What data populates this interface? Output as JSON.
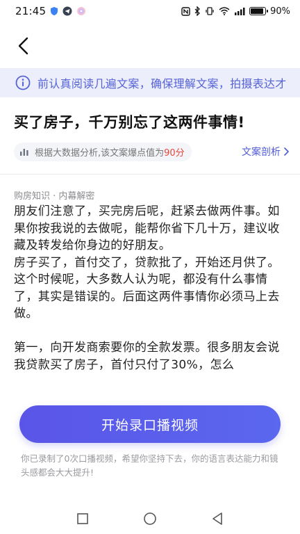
{
  "status_bar": {
    "time": "21:45",
    "battery_text": "90%",
    "battery_level": 0.9,
    "icons": [
      "shield-icon",
      "telegram-icon",
      "color-wheel-icon",
      "nfc-icon",
      "bluetooth-icon",
      "vibrate-icon",
      "wifi-icon",
      "signal-icon",
      "battery-icon"
    ]
  },
  "header": {
    "back_icon": "chevron-left-icon"
  },
  "tip_banner": {
    "icon": "info-icon",
    "text": "前认真阅读几遍文案，确保理解文案，拍摄表达才",
    "color": "#5563d6"
  },
  "article": {
    "title": "买了房子，千万别忘了这两件事情!",
    "score_prefix": "根据大数据分析,该文案爆点值为",
    "score_value": "90分",
    "analysis_link": "文案剖析",
    "category": "购房知识 · 内幕解密",
    "paragraphs": [
      "朋友们注意了，买完房后呢，赶紧去做两件事。如果你按我说的去做呢，能帮你省下几十万，建议收藏及转发给你身边的好朋友。",
      "房子买了，首付交了，贷款批了，开始还月供了。这个时候呢，大多数人认为呢，都没有什么事情了，其实是错误的。后面这两件事情你必须马上去做。",
      "第一，向开发商索要你的全款发票。很多朋友会说我贷款买了房子，首付只付了30%，怎么"
    ]
  },
  "record": {
    "button_label": "开始录口播视频",
    "note": "你已录制了0次口播视频，希望你坚持下去，你的语言表达能力和镜头感都会大大提升!",
    "accent": "#5a5ee8"
  },
  "nav_bar": {
    "icons": [
      "square-icon",
      "circle-icon",
      "triangle-back-icon"
    ]
  }
}
